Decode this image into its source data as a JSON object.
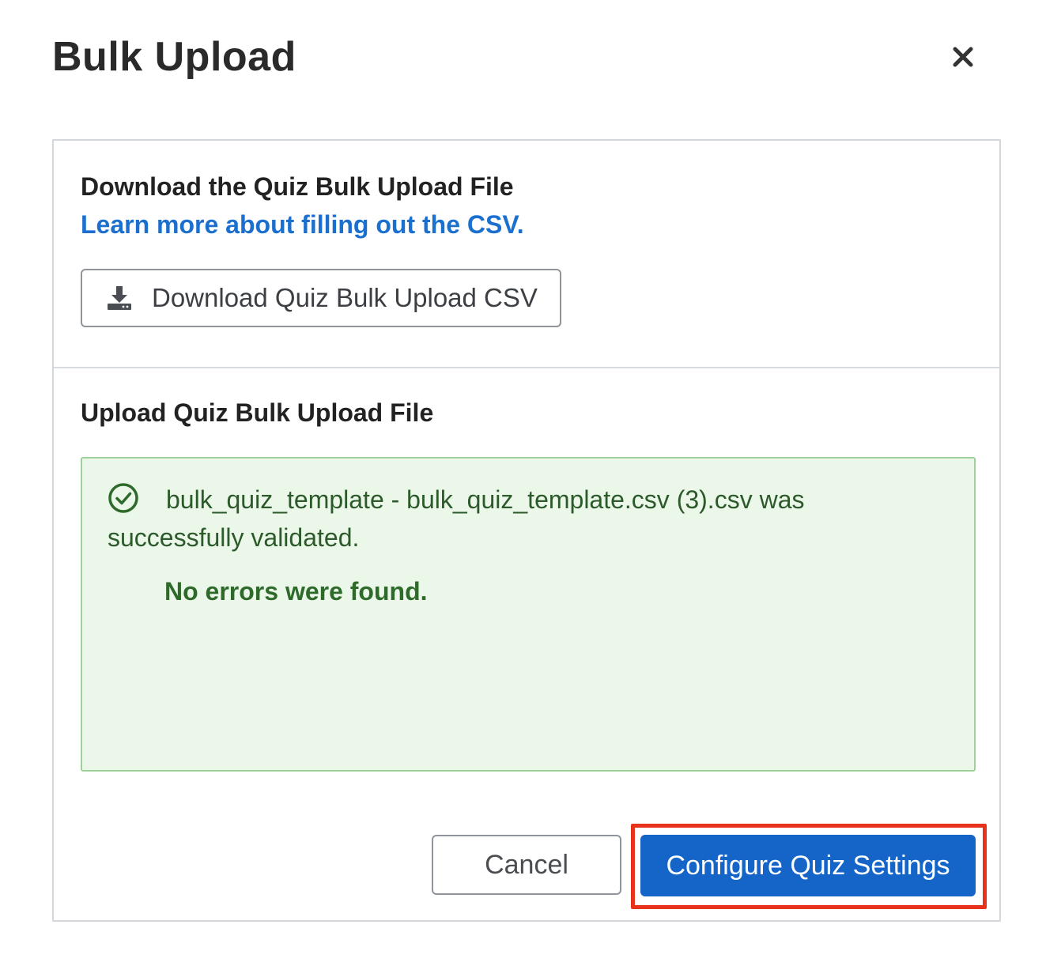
{
  "modal": {
    "title": "Bulk Upload",
    "close_icon": "close-icon"
  },
  "download_section": {
    "heading": "Download the Quiz Bulk Upload File",
    "link_text": "Learn more about filling out the CSV.",
    "button_label": "Download Quiz Bulk Upload CSV",
    "button_icon": "download-icon"
  },
  "upload_section": {
    "heading": "Upload Quiz Bulk Upload File",
    "alert": {
      "icon": "check-circle-icon",
      "message": "bulk_quiz_template - bulk_quiz_template.csv (3).csv was successfully validated.",
      "detail": "No errors were found."
    }
  },
  "footer": {
    "cancel_label": "Cancel",
    "primary_label": "Configure Quiz Settings"
  },
  "colors": {
    "link": "#1a6fcf",
    "primary": "#1565c9",
    "success_bg": "#ebf7e9",
    "success_border": "#9ed19a",
    "success_text": "#2e6b2b",
    "highlight": "#e8321c"
  }
}
